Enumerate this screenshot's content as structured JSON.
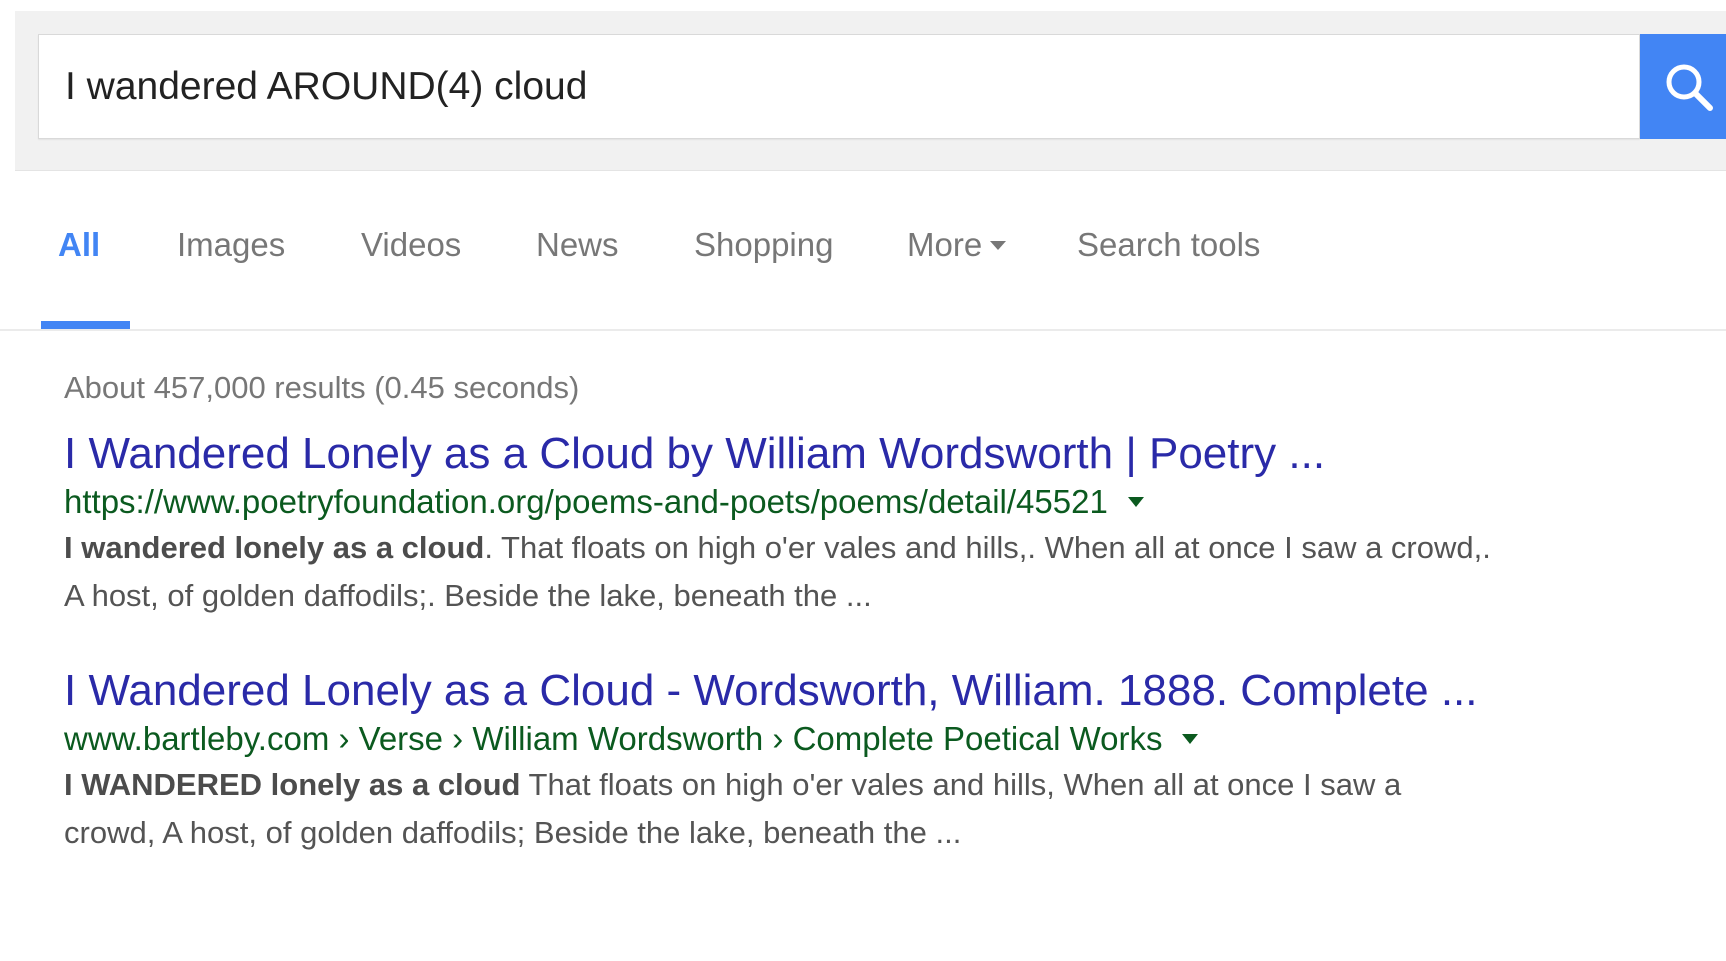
{
  "search": {
    "query": "I wandered AROUND(4) cloud"
  },
  "tabs": [
    {
      "label": "All",
      "active": true
    },
    {
      "label": "Images",
      "active": false
    },
    {
      "label": "Videos",
      "active": false
    },
    {
      "label": "News",
      "active": false
    },
    {
      "label": "Shopping",
      "active": false
    },
    {
      "label": "More",
      "active": false
    },
    {
      "label": "Search tools",
      "active": false
    }
  ],
  "stats": "About 457,000 results (0.45 seconds)",
  "results": [
    {
      "title": "I Wandered Lonely as a Cloud by William Wordsworth | Poetry ...",
      "url": "https://www.poetryfoundation.org/poems-and-poets/poems/detail/45521",
      "snippet_bold_1": "I wandered lonely as a cloud",
      "snippet_rest_1": ". That floats on high o'er vales and hills,. When all at once I saw a crowd,.",
      "snippet_line_2": "A host, of golden daffodils;. Beside the lake, beneath the ..."
    },
    {
      "title": "I Wandered Lonely as a Cloud - Wordsworth, William. 1888. Complete ...",
      "url": "www.bartleby.com › Verse › William Wordsworth › Complete Poetical Works",
      "snippet_bold_1": "I WANDERED lonely as a cloud",
      "snippet_rest_1": " That floats on high o'er vales and hills, When all at once I saw a",
      "snippet_line_2": "crowd, A host, of golden daffodils; Beside the lake, beneath the ..."
    }
  ],
  "colors": {
    "accent": "#4285f4",
    "link": "#2a2aa8",
    "url": "#0b5a1f",
    "muted": "#777777",
    "snippet": "#545454"
  }
}
